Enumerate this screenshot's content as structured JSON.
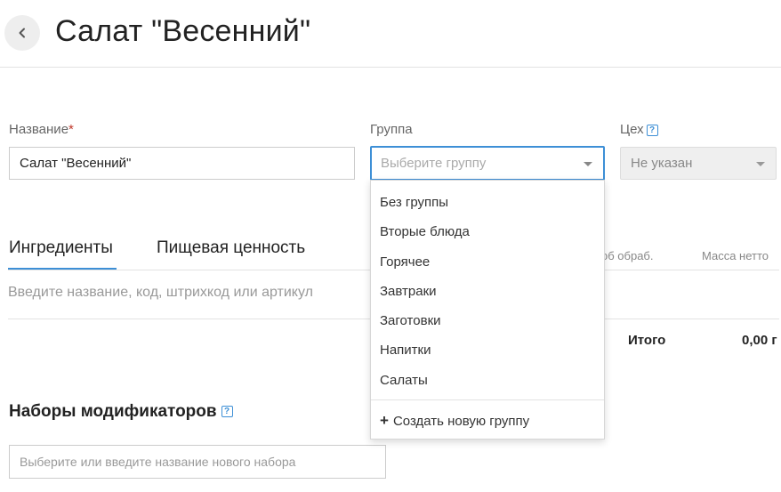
{
  "header": {
    "title": "Салат \"Весенний\""
  },
  "form": {
    "name_label": "Название",
    "name_required": "*",
    "name_value": "Салат \"Весенний\"",
    "group_label": "Группа",
    "group_placeholder": "Выберите группу",
    "workshop_label": "Цех",
    "workshop_value": "Не указан"
  },
  "tabs": {
    "ingredients": "Ингредиенты",
    "nutrition": "Пищевая ценность"
  },
  "table": {
    "col_processing": "об обраб.",
    "col_net_weight": "Масса нетто",
    "search_placeholder": "Введите название, код, штрихкод или артикул",
    "total_label": "Итого",
    "total_value": "0,00 г"
  },
  "modifiers": {
    "title": "Наборы модификаторов",
    "placeholder": "Выберите или введите название нового набора"
  },
  "group_dropdown": {
    "items": [
      "Без группы",
      "Вторые блюда",
      "Горячее",
      "Завтраки",
      "Заготовки",
      "Напитки",
      "Салаты"
    ],
    "create_label": "Создать новую группу"
  },
  "icons": {
    "back": "chevron-left-icon",
    "help": "question-icon",
    "caret": "caret-down-icon",
    "plus": "plus-icon"
  },
  "colors": {
    "accent": "#3d8fd6",
    "required": "#c0392b"
  }
}
